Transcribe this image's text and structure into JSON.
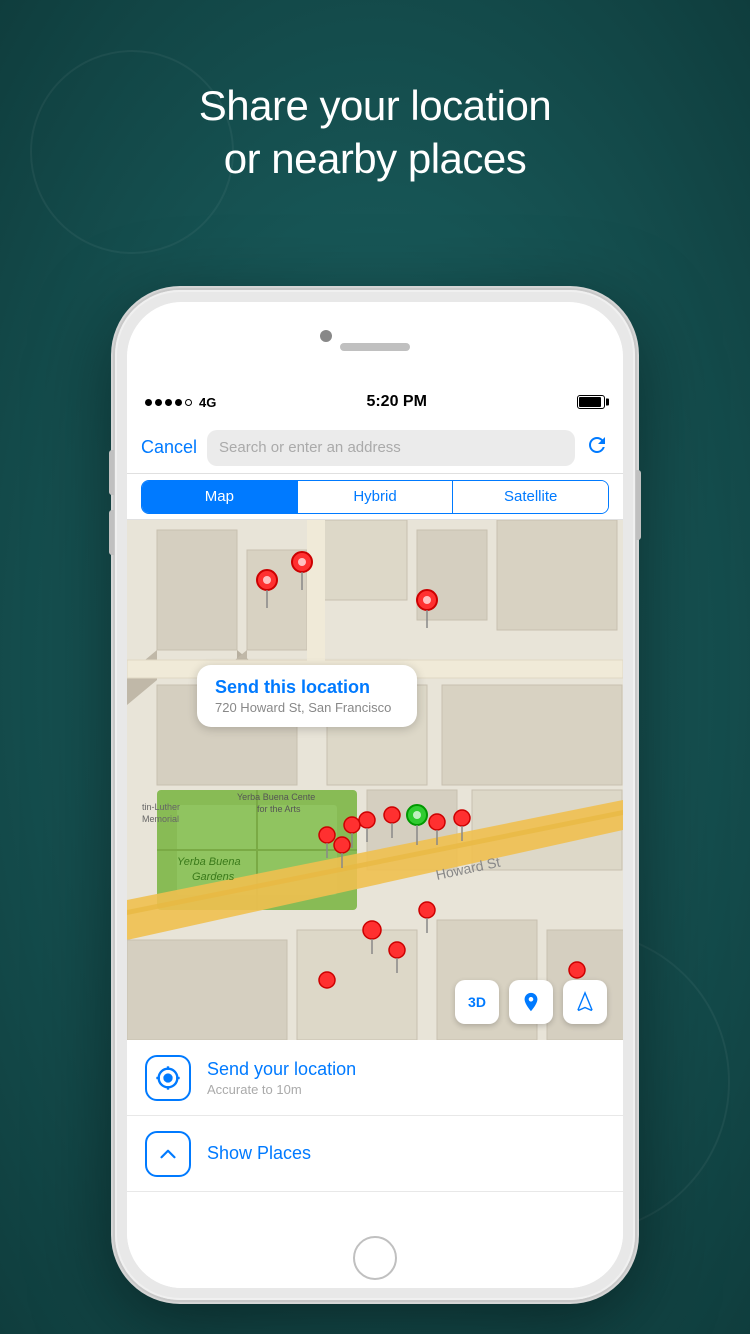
{
  "background": {
    "color": "#1a5a5a"
  },
  "headline": {
    "line1": "Share your location",
    "line2": "or nearby places"
  },
  "status_bar": {
    "signal_dots": 4,
    "network": "4G",
    "time": "5:20 PM",
    "battery_full": true
  },
  "search_bar": {
    "cancel_label": "Cancel",
    "placeholder": "Search or enter an address"
  },
  "map_tabs": {
    "items": [
      "Map",
      "Hybrid",
      "Satellite"
    ],
    "active": 0
  },
  "map": {
    "callout": {
      "title": "Send this location",
      "address": "720 Howard St, San Francisco"
    },
    "area_label": "Yerba Buena Gardens",
    "martin_luther_label": "tin-Luther Memorial"
  },
  "map_controls": [
    {
      "label": "3D",
      "icon": "3d-icon"
    },
    {
      "label": "📍",
      "icon": "pin-icon"
    },
    {
      "label": "↗",
      "icon": "navigate-icon"
    }
  ],
  "list_items": [
    {
      "icon": "location-current-icon",
      "icon_unicode": "⦿",
      "title": "Send your location",
      "subtitle": "Accurate to 10m"
    },
    {
      "icon": "show-places-icon",
      "icon_unicode": "⬆",
      "title": "Show Places",
      "subtitle": ""
    }
  ]
}
